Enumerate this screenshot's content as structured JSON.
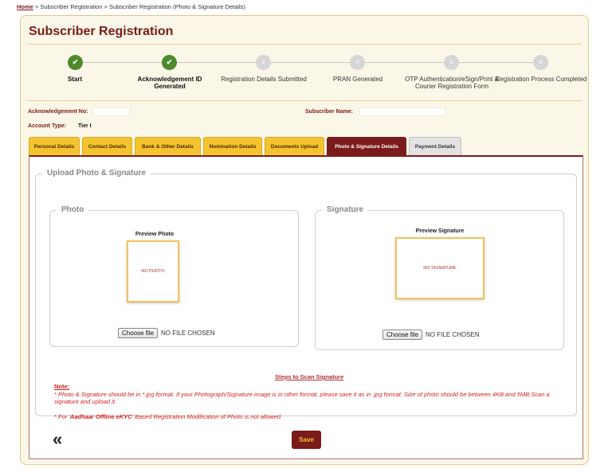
{
  "breadcrumb": {
    "home": "Home",
    "separator": ">",
    "level1": "Subscriber Registration",
    "level2": "Subscriber Registration (Photo & Signature Details)"
  },
  "page_title": "Subscriber Registration",
  "steps": [
    {
      "label": "Start",
      "status": "done",
      "marker": "✔"
    },
    {
      "label": "Acknowledgement ID Generated",
      "status": "done",
      "marker": "✔"
    },
    {
      "label": "Registration Details Submitted",
      "status": "pending",
      "marker": "3"
    },
    {
      "label": "PRAN Generated",
      "status": "pending",
      "marker": "4"
    },
    {
      "label": "OTP Authentication/eSign/Print & Courier Registration Form",
      "status": "pending",
      "marker": "5"
    },
    {
      "label": "Registration Process Completed",
      "status": "pending",
      "marker": "6"
    }
  ],
  "info": {
    "ack_label": "Acknowledgement No:",
    "ack_value": "",
    "subscriber_label": "Subscriber Name:",
    "subscriber_value": "",
    "account_type_label": "Account Type:",
    "account_type_value": "Tier I"
  },
  "tabs": [
    {
      "label": "Personal Details",
      "state": "normal"
    },
    {
      "label": "Contact Details",
      "state": "normal"
    },
    {
      "label": "Bank & Other Details",
      "state": "normal"
    },
    {
      "label": "Nomination Details",
      "state": "normal"
    },
    {
      "label": "Documents Upload",
      "state": "normal"
    },
    {
      "label": "Photo & Signature Details",
      "state": "active"
    },
    {
      "label": "Payment Details",
      "state": "disabled"
    }
  ],
  "upload": {
    "legend": "Upload Photo & Signature",
    "photo": {
      "legend": "Photo",
      "preview_title": "Preview Photo",
      "placeholder": "NO PHOTO",
      "button": "Choose file",
      "status": "NO FILE CHOSEN"
    },
    "signature": {
      "legend": "Signature",
      "preview_title": "Preview Signature",
      "placeholder": "NO SIGNATURE",
      "button": "Choose file",
      "status": "NO FILE CHOSEN"
    },
    "steps_link": "Steps to Scan Signature",
    "note_title": "Note:",
    "note_line1": "* Photo & Signature should be in *.jpg format. If your Photograph/Signature image is in other format, please save it as in .jpg format. Size of photo should be between 4KB and 5MB.Scan a signature and upload it.",
    "note_line2_prefix": "* For '",
    "note_line2_bold": "Aadhaar Offline eKYC",
    "note_line2_suffix": "' Based Registration Modification of Photo is not allowed"
  },
  "actions": {
    "back": "«",
    "save": "Save"
  },
  "colors": {
    "brand": "#7a1a1a",
    "tab_yellow": "#f4c430",
    "done_green": "#4e8a2a",
    "note_red": "#d21e1e"
  }
}
